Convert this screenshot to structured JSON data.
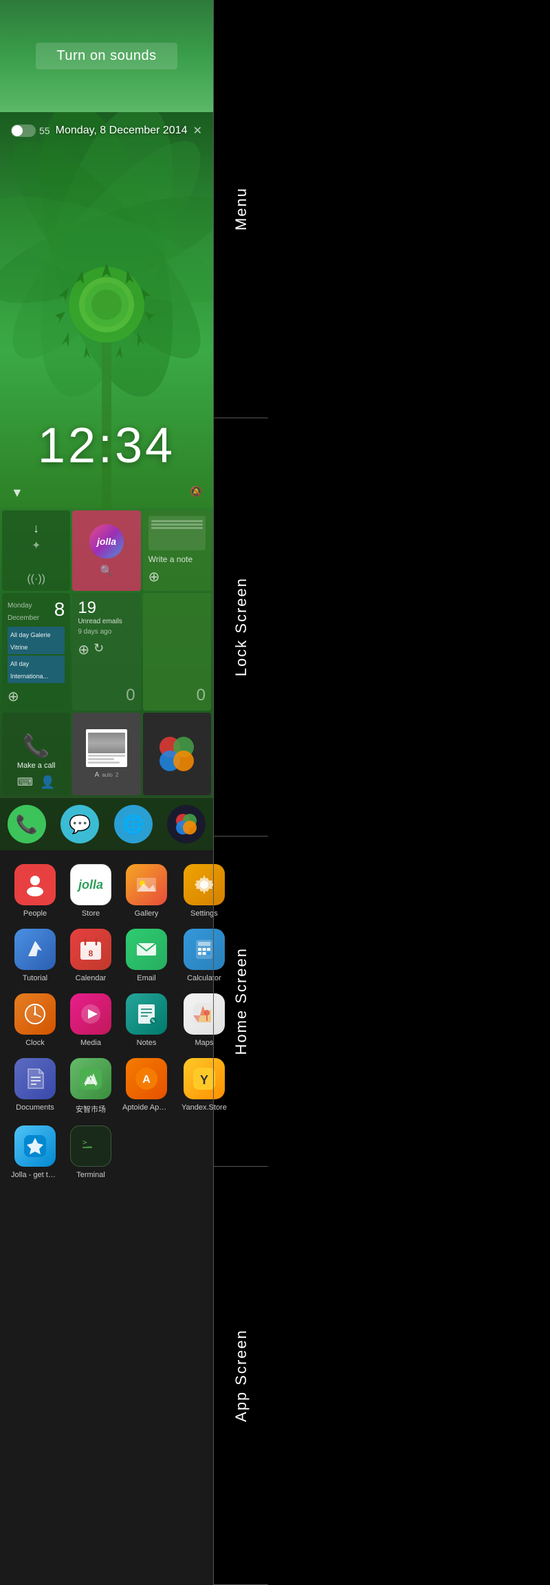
{
  "sections": {
    "menu": {
      "label": "Menu",
      "height": 163,
      "banner_text": "Turn on sounds"
    },
    "lock_screen": {
      "label": "Lock Screen",
      "date": "Monday, 8 December 2014",
      "time": "12:34",
      "volume_value": "55"
    },
    "home_screen": {
      "label": "Home Screen",
      "tiles": [
        {
          "id": "settings-arrows",
          "type": "arrows"
        },
        {
          "id": "jolla-store",
          "label": "jolla",
          "type": "jolla"
        },
        {
          "id": "notes",
          "label": "Write a note",
          "type": "notes"
        },
        {
          "id": "bluetooth-wifi",
          "type": "connectivity"
        },
        {
          "id": "search",
          "type": "search"
        },
        {
          "id": "add",
          "type": "add"
        },
        {
          "id": "calendar",
          "day": "8",
          "month": "Monday December",
          "events": [
            "All day Galerie Vitrine",
            "All day Internationa..."
          ],
          "type": "calendar"
        },
        {
          "id": "email",
          "count": "19",
          "label": "Unread emails",
          "sublabel": "9 days ago",
          "type": "email"
        },
        {
          "id": "notes-count",
          "count": "0",
          "type": "notes-count"
        },
        {
          "id": "phone",
          "label": "Make a call",
          "type": "phone"
        },
        {
          "id": "browser",
          "type": "browser"
        },
        {
          "id": "camera",
          "type": "camera"
        }
      ],
      "dock": [
        {
          "id": "phone-dock",
          "icon": "📞"
        },
        {
          "id": "messages-dock",
          "icon": "💬"
        },
        {
          "id": "browser-dock",
          "icon": "🌐"
        },
        {
          "id": "camera-dock",
          "icon": "📷"
        }
      ]
    },
    "app_screen": {
      "label": "App Screen",
      "apps": [
        {
          "id": "people",
          "name": "People",
          "icon_class": "icon-people",
          "icon_char": "👤"
        },
        {
          "id": "store",
          "name": "Store",
          "icon_class": "icon-store",
          "icon_char": "jolla"
        },
        {
          "id": "gallery",
          "name": "Gallery",
          "icon_class": "icon-gallery",
          "icon_char": "🖼"
        },
        {
          "id": "settings",
          "name": "Settings",
          "icon_class": "icon-settings",
          "icon_char": "⚙"
        },
        {
          "id": "tutorial",
          "name": "Tutorial",
          "icon_class": "icon-tutorial",
          "icon_char": "✈"
        },
        {
          "id": "calendar",
          "name": "Calendar",
          "icon_class": "icon-calendar",
          "icon_char": "📅"
        },
        {
          "id": "email",
          "name": "Email",
          "icon_class": "icon-email",
          "icon_char": "✉"
        },
        {
          "id": "calculator",
          "name": "Calculator",
          "icon_class": "icon-calculator",
          "icon_char": "🔢"
        },
        {
          "id": "clock",
          "name": "Clock",
          "icon_class": "icon-clock",
          "icon_char": "⏰"
        },
        {
          "id": "media",
          "name": "Media",
          "icon_class": "icon-media",
          "icon_char": "▶"
        },
        {
          "id": "notes",
          "name": "Notes",
          "icon_class": "icon-notes",
          "icon_char": "📝"
        },
        {
          "id": "maps",
          "name": "Maps",
          "icon_class": "icon-maps",
          "icon_char": "🗺"
        },
        {
          "id": "documents",
          "name": "Documents",
          "icon_class": "icon-documents",
          "icon_char": "📄"
        },
        {
          "id": "anzhi",
          "name": "安智市场",
          "icon_class": "icon-anzhi",
          "icon_char": "🛍"
        },
        {
          "id": "aptoide",
          "name": "Aptoide Apps...",
          "icon_class": "icon-aptoide",
          "icon_char": "A"
        },
        {
          "id": "yandex",
          "name": "Yandex.Store",
          "icon_class": "icon-yandex",
          "icon_char": "Y"
        },
        {
          "id": "jolla-app",
          "name": "Jolla - get to ...",
          "icon_class": "icon-jolla",
          "icon_char": "★"
        },
        {
          "id": "terminal",
          "name": "Terminal",
          "icon_class": "icon-terminal",
          "icon_char": ">_"
        }
      ]
    }
  }
}
